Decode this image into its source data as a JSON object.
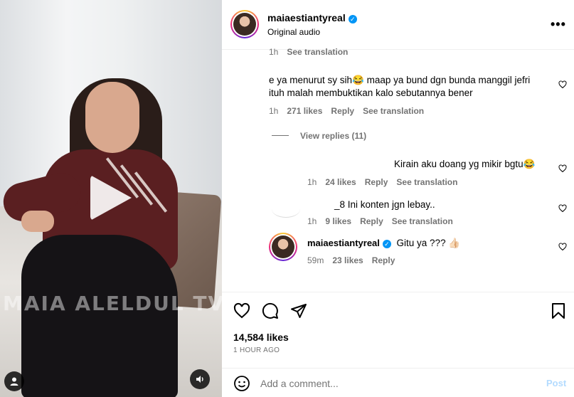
{
  "video": {
    "watermark": "MAIA ALELDUL TV"
  },
  "post": {
    "username": "maiaestiantyreal",
    "subtitle": "Original audio"
  },
  "comments": [
    {
      "text": "",
      "time": "1h",
      "likes": "",
      "reply": "",
      "translate": "See translation"
    },
    {
      "text": "e ya menurut sy sih😂 maap ya bund dgn bunda manggil jefri ituh malah membuktikan kalo sebutannya bener",
      "time": "1h",
      "likes": "271 likes",
      "reply": "Reply",
      "translate": "See translation",
      "view_replies": "View replies (11)"
    },
    {
      "text": "Kirain aku doang yg mikir bgtu😂",
      "time": "1h",
      "likes": "24 likes",
      "reply": "Reply",
      "translate": "See translation"
    },
    {
      "text": "_8 Ini konten jgn lebay..",
      "time": "1h",
      "likes": "9 likes",
      "reply": "Reply",
      "translate": "See translation"
    },
    {
      "username": "maiaestiantyreal",
      "text": "Gitu ya ??? 👍🏻",
      "time": "59m",
      "likes": "23 likes",
      "reply": "Reply"
    }
  ],
  "stats": {
    "likes": "14,584 likes",
    "time_ago": "1 HOUR AGO"
  },
  "composer": {
    "placeholder": "Add a comment...",
    "post_label": "Post"
  },
  "colors": {
    "verified": "#0095f6",
    "muted_text": "#737373",
    "post_disabled": "#b3dbff"
  }
}
